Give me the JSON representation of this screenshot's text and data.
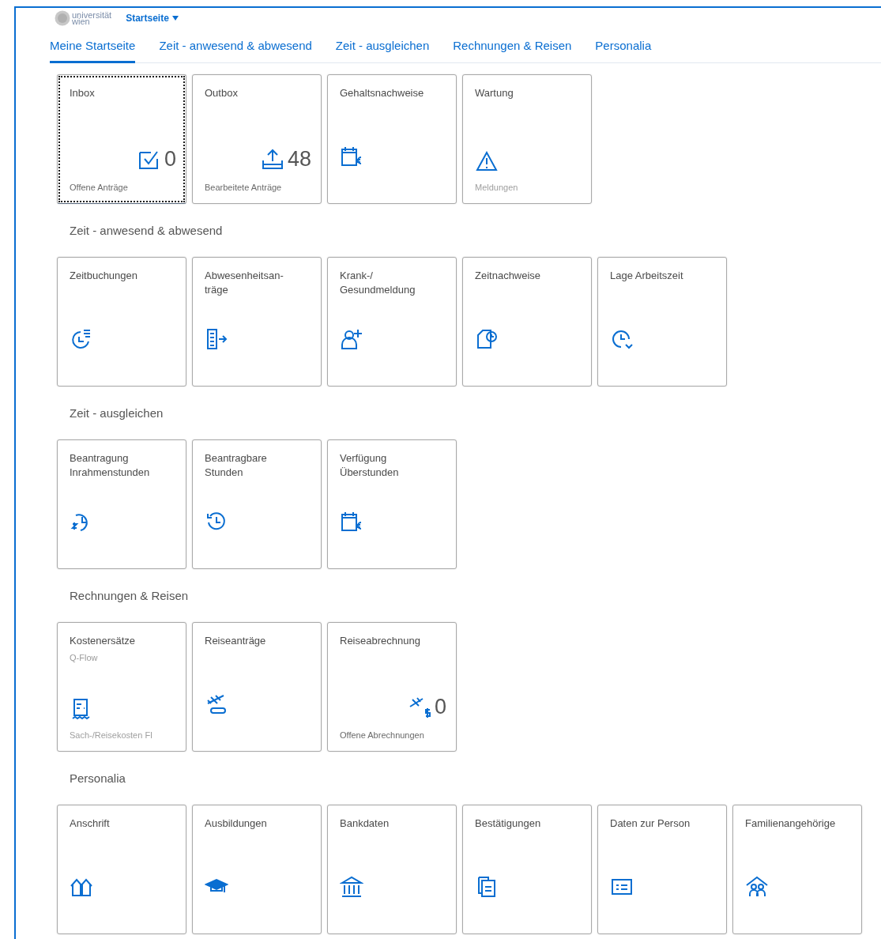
{
  "header": {
    "logo_line_1": "universität",
    "logo_line_2": "wien",
    "menu": "Startseite"
  },
  "tabs": [
    {
      "label": "Meine Startseite",
      "selected": true
    },
    {
      "label": "Zeit - anwesend & abwesend",
      "selected": false
    },
    {
      "label": "Zeit - ausgleichen",
      "selected": false
    },
    {
      "label": "Rechnungen & Reisen",
      "selected": false
    },
    {
      "label": "Personalia",
      "selected": false
    }
  ],
  "groups": [
    {
      "tiles": [
        {
          "title": "Inbox",
          "number": "0",
          "footer": "Offene Anträge",
          "focused": true
        },
        {
          "title": "Outbox",
          "number": "48",
          "footer": "Bearbeitete Anträge",
          "focused": false
        },
        {
          "title": "Gehaltsnachweise",
          "focused": false
        },
        {
          "title": "Wartung",
          "footer": "Meldungen",
          "focused": false
        }
      ]
    },
    {
      "heading": "Zeit - anwesend & abwesend",
      "tiles": [
        {
          "title": "Zeitbuchungen",
          "focused": false
        },
        {
          "title": "Abwesenheitsan-\nträge",
          "focused": false
        },
        {
          "title": "Krank-/\nGesundmeldung",
          "focused": false
        },
        {
          "title": "Zeitnachweise",
          "focused": false
        },
        {
          "title": "Lage Arbeitszeit",
          "focused": false
        }
      ]
    },
    {
      "heading": "Zeit - ausgleichen",
      "tiles": [
        {
          "title": "Beantragung\nInrahmenstunden",
          "focused": false
        },
        {
          "title": "Beantragbare\nStunden",
          "focused": false
        },
        {
          "title": "Verfügung\nÜberstunden",
          "focused": false
        }
      ]
    },
    {
      "heading": "Rechnungen & Reisen",
      "tiles": [
        {
          "title": "Kostenersätze",
          "subtitle": "Q-Flow",
          "footer": "Sach-/Reisekosten FI",
          "focused": false
        },
        {
          "title": "Reiseanträge",
          "focused": false
        },
        {
          "title": "Reiseabrechnung",
          "number": "0",
          "footer": "Offene Abrechnungen",
          "focused": false
        }
      ]
    },
    {
      "heading": "Personalia",
      "tiles": [
        {
          "title": "Anschrift",
          "focused": false
        },
        {
          "title": "Ausbildungen",
          "focused": false
        },
        {
          "title": "Bankdaten",
          "focused": false
        },
        {
          "title": "Bestätigungen",
          "focused": false
        },
        {
          "title": "Daten zur Person",
          "focused": false
        },
        {
          "title": "Familienangehörige",
          "focused": false
        }
      ]
    }
  ]
}
